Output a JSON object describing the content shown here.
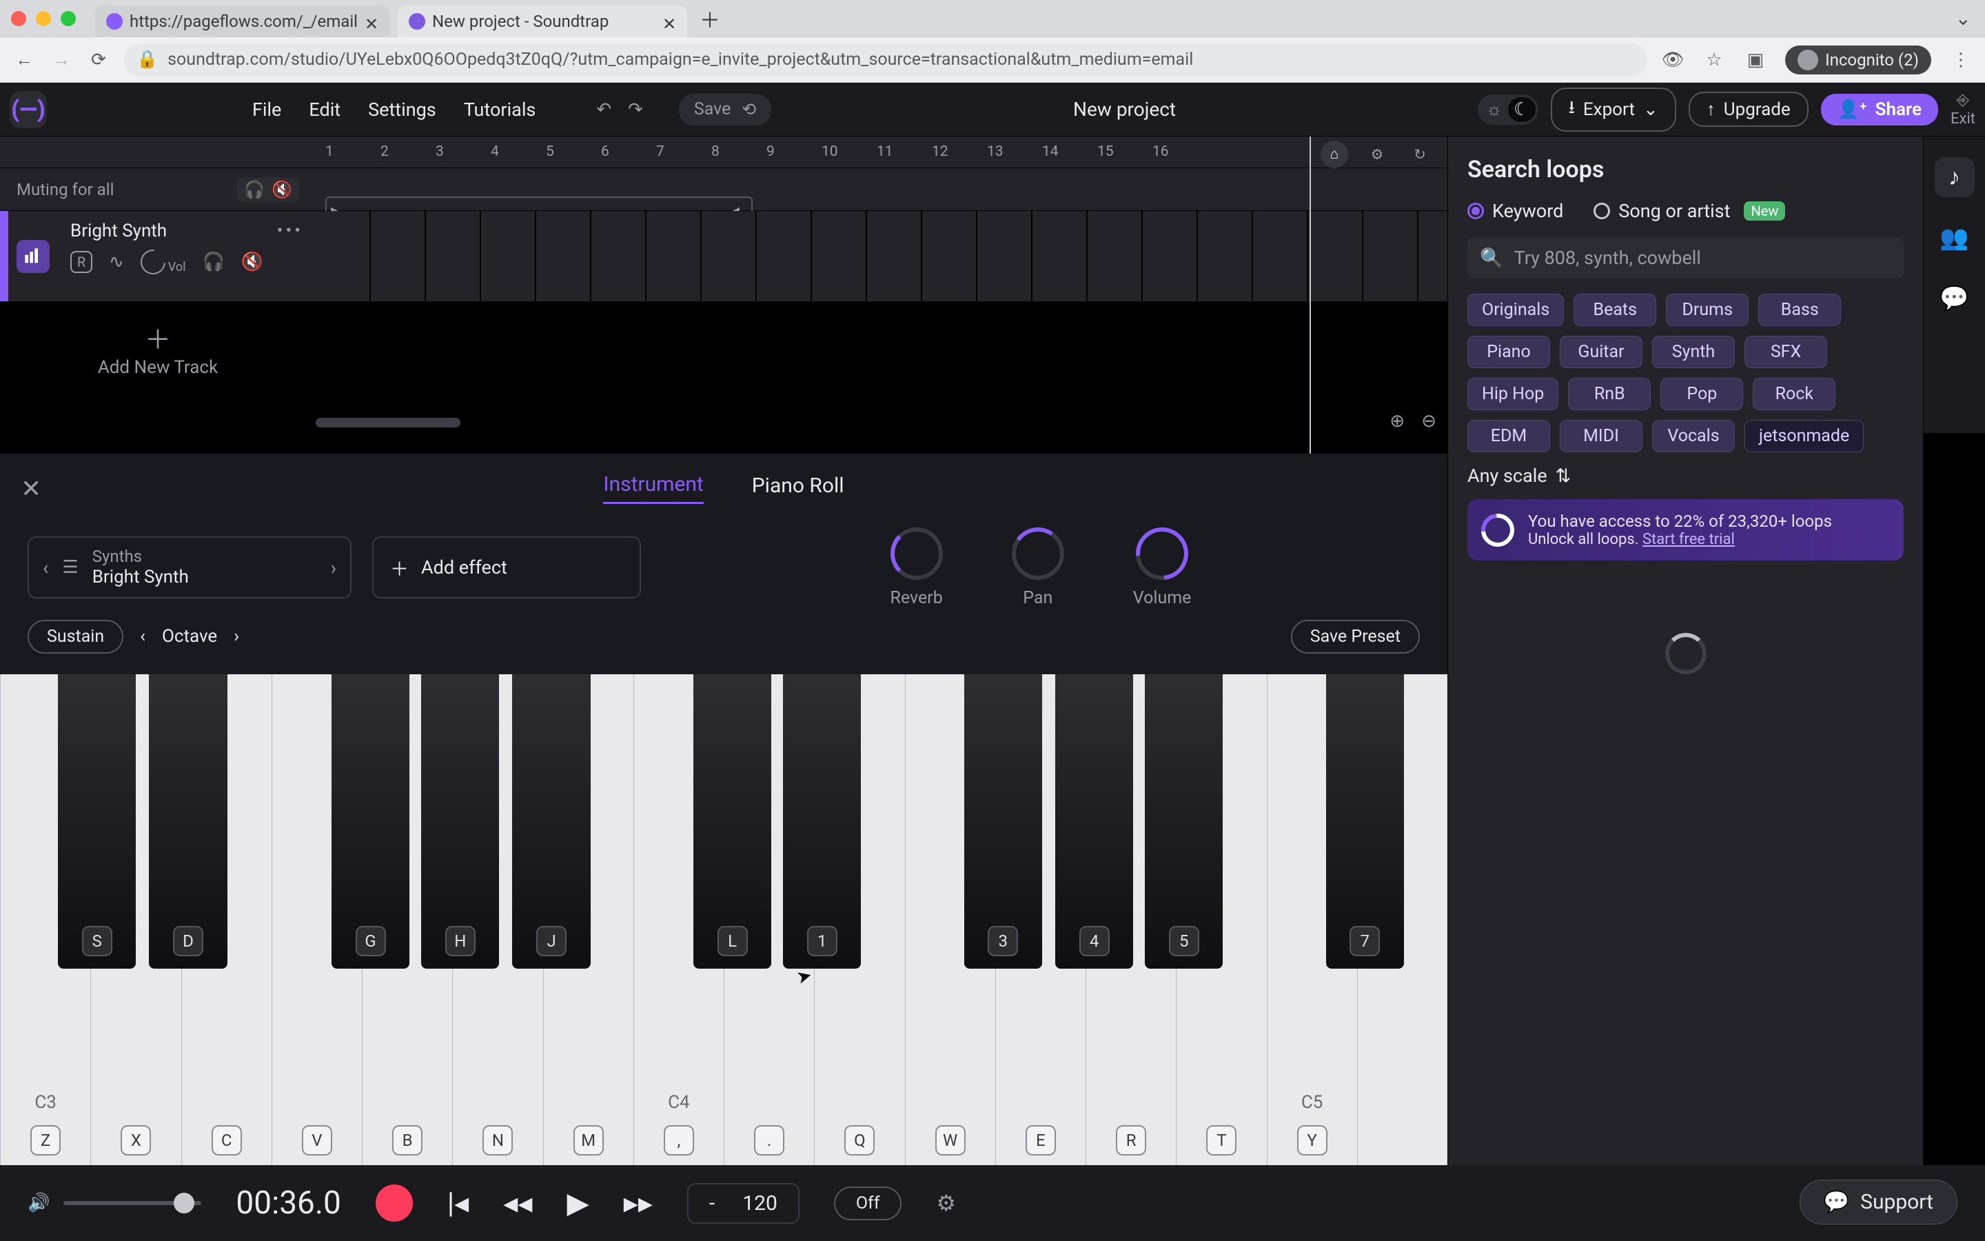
{
  "browser": {
    "tabs": [
      {
        "title": "https://pageflows.com/_/email",
        "active": false
      },
      {
        "title": "New project - Soundtrap",
        "active": true
      }
    ],
    "url": "soundtrap.com/studio/UYeLebx0Q6OOpedq3tZ0qQ/?utm_campaign=e_invite_project&utm_source=transactional&utm_medium=email",
    "incognito_label": "Incognito (2)"
  },
  "app": {
    "menu": {
      "file": "File",
      "edit": "Edit",
      "settings": "Settings",
      "tutorials": "Tutorials"
    },
    "save_label": "Save",
    "project_title": "New project",
    "export": "Export",
    "upgrade": "Upgrade",
    "share": "Share",
    "exit": "Exit"
  },
  "timeline": {
    "mute_label": "Muting for all",
    "bars": [
      "1",
      "2",
      "3",
      "4",
      "5",
      "6",
      "7",
      "8",
      "9",
      "10",
      "11",
      "12",
      "13",
      "14",
      "15",
      "16"
    ],
    "track": {
      "name": "Bright Synth",
      "add_new": "Add New Track"
    }
  },
  "instrument": {
    "tabs": {
      "instrument": "Instrument",
      "pianoroll": "Piano Roll"
    },
    "category": "Synths",
    "name": "Bright Synth",
    "add_effect": "Add effect",
    "knobs": {
      "reverb": "Reverb",
      "pan": "Pan",
      "volume": "Volume"
    },
    "sustain": "Sustain",
    "octave": "Octave",
    "save_preset": "Save Preset",
    "white_keys": [
      {
        "n": "C3",
        "k": "Z"
      },
      {
        "n": "",
        "k": "X"
      },
      {
        "n": "",
        "k": "C"
      },
      {
        "n": "",
        "k": "V"
      },
      {
        "n": "",
        "k": "B"
      },
      {
        "n": "",
        "k": "N"
      },
      {
        "n": "",
        "k": "M"
      },
      {
        "n": "C4",
        "k": ","
      },
      {
        "n": "",
        "k": "."
      },
      {
        "n": "",
        "k": "Q"
      },
      {
        "n": "",
        "k": "W"
      },
      {
        "n": "",
        "k": "E"
      },
      {
        "n": "",
        "k": "R"
      },
      {
        "n": "",
        "k": "T"
      },
      {
        "n": "C5",
        "k": "Y"
      },
      {
        "n": "",
        "k": ""
      }
    ],
    "black_keys": [
      {
        "pos": 4.0,
        "k": "S"
      },
      {
        "pos": 10.3,
        "k": "D"
      },
      {
        "pos": 22.9,
        "k": "G"
      },
      {
        "pos": 29.1,
        "k": "H"
      },
      {
        "pos": 35.4,
        "k": "J"
      },
      {
        "pos": 47.9,
        "k": "L"
      },
      {
        "pos": 54.1,
        "k": "1"
      },
      {
        "pos": 66.6,
        "k": "3"
      },
      {
        "pos": 72.9,
        "k": "4"
      },
      {
        "pos": 79.1,
        "k": "5"
      },
      {
        "pos": 91.6,
        "k": "7"
      }
    ]
  },
  "transport": {
    "time": "00:36.0",
    "tempo_left": "-",
    "bpm": "120",
    "metronome": "Off"
  },
  "loops": {
    "title": "Search loops",
    "radios": {
      "keyword": "Keyword",
      "song": "Song or artist",
      "new": "New"
    },
    "placeholder": "Try 808, synth, cowbell",
    "chips": [
      "Originals",
      "Beats",
      "Drums",
      "Bass",
      "Piano",
      "Guitar",
      "Synth",
      "SFX",
      "Hip Hop",
      "RnB",
      "Pop",
      "Rock",
      "EDM",
      "MIDI",
      "Vocals",
      "jetsonmade"
    ],
    "scale": "Any scale",
    "unlock": {
      "line": "You have access to 22% of 23,320+ loops",
      "sub": "Unlock all loops. ",
      "link": "Start free trial"
    }
  },
  "support": "Support"
}
